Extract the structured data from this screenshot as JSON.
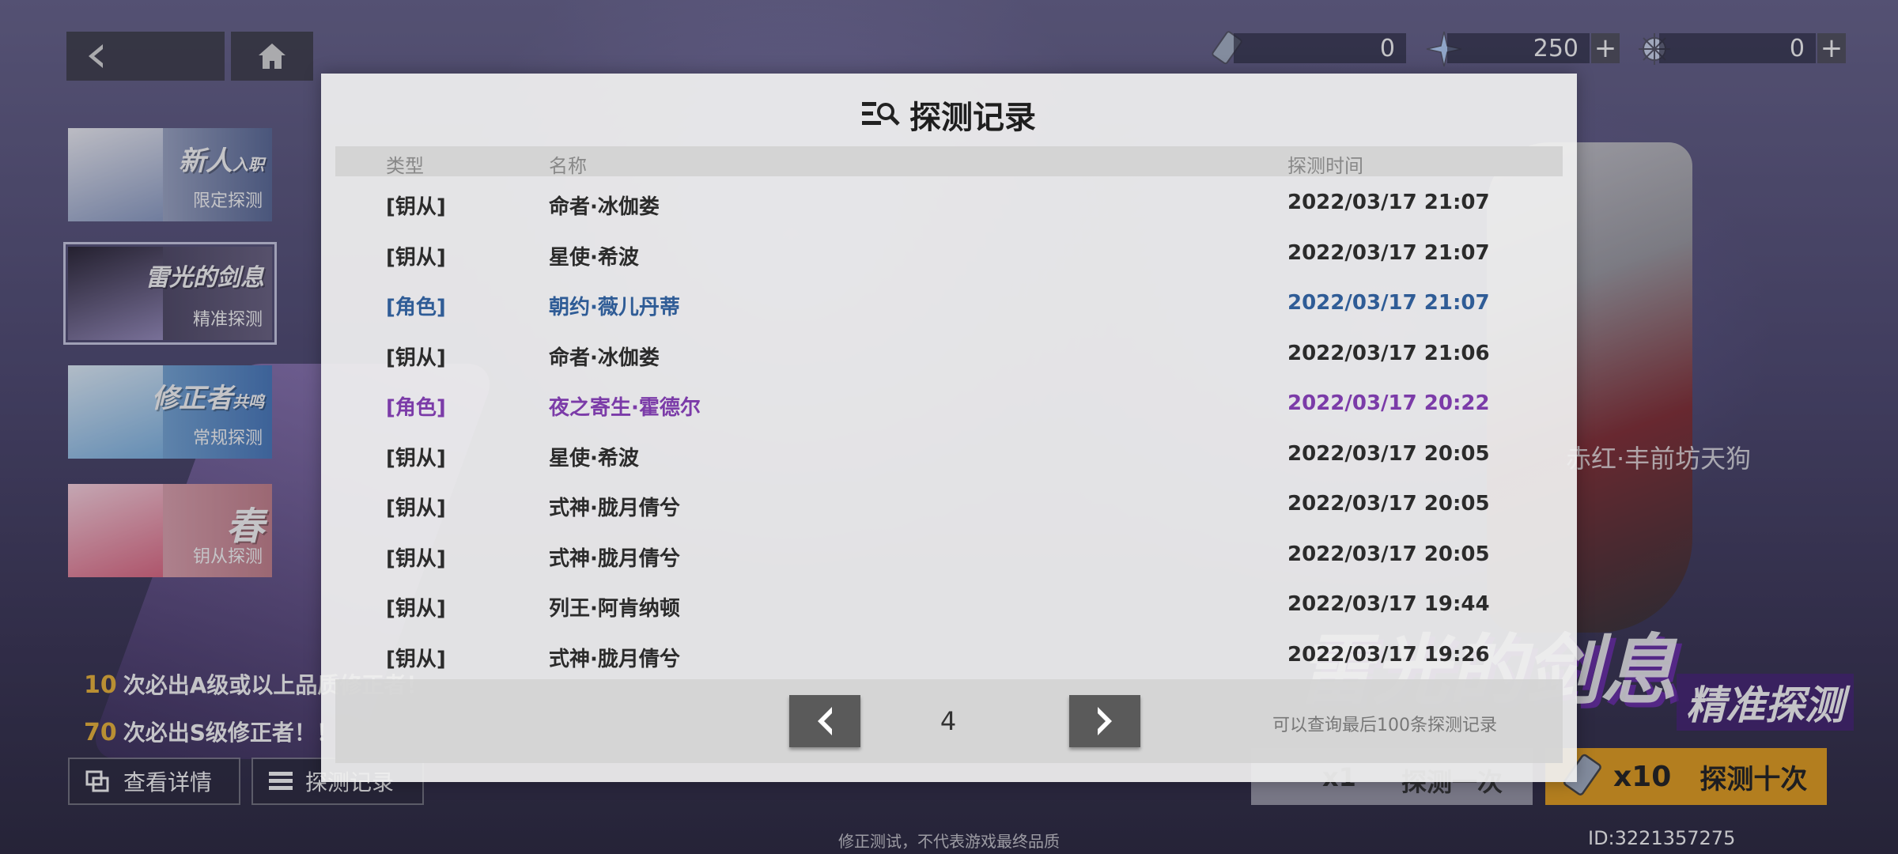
{
  "top_nav": {
    "back": "back",
    "home": "home"
  },
  "currencies": [
    {
      "icon": "card-ticket-icon",
      "value": "0"
    },
    {
      "icon": "star-crystal-icon",
      "value": "250"
    },
    {
      "icon": "snowflake-crystal-icon",
      "value": "0"
    }
  ],
  "banners": [
    {
      "title": "新人",
      "title_small": "入职",
      "sub": "限定探测"
    },
    {
      "title": "雷光的剑息",
      "sub": "精准探测"
    },
    {
      "title": "修正者",
      "title_small": "共鸣",
      "sub": "常规探测"
    },
    {
      "title": "春",
      "sub": "钥从探测"
    }
  ],
  "pity": [
    {
      "num": "10",
      "text": "次必出A级或以上品质修正者！"
    },
    {
      "num": "70",
      "text": "次必出S级修正者！！"
    }
  ],
  "bottom_buttons": {
    "details": "查看详情",
    "records": "探测记录"
  },
  "draw": {
    "one_count": "x1",
    "one_label": "探测一次",
    "ten_count": "x10",
    "ten_label": "探测十次"
  },
  "background": {
    "banner_title": "雷光的剑息",
    "banner_sub": "精准探测",
    "character_name": "赤红·丰前坊天狗"
  },
  "footer_note": "修正测试，不代表游戏最终品质",
  "uid": "ID:3221357275",
  "modal": {
    "title": "探测记录",
    "columns": {
      "type": "类型",
      "name": "名称",
      "time": "探测时间"
    },
    "rows": [
      {
        "type": "[钥从]",
        "name": "命者·冰伽娄",
        "time": "2022/03/17 21:07",
        "rarity": "normal"
      },
      {
        "type": "[钥从]",
        "name": "星使·希波",
        "time": "2022/03/17 21:07",
        "rarity": "normal"
      },
      {
        "type": "[角色]",
        "name": "朝约·薇儿丹蒂",
        "time": "2022/03/17 21:07",
        "rarity": "blue"
      },
      {
        "type": "[钥从]",
        "name": "命者·冰伽娄",
        "time": "2022/03/17 21:06",
        "rarity": "normal"
      },
      {
        "type": "[角色]",
        "name": "夜之寄生·霍德尔",
        "time": "2022/03/17 20:22",
        "rarity": "purple"
      },
      {
        "type": "[钥从]",
        "name": "星使·希波",
        "time": "2022/03/17 20:05",
        "rarity": "normal"
      },
      {
        "type": "[钥从]",
        "name": "式神·胧月倩兮",
        "time": "2022/03/17 20:05",
        "rarity": "normal"
      },
      {
        "type": "[钥从]",
        "name": "式神·胧月倩兮",
        "time": "2022/03/17 20:05",
        "rarity": "normal"
      },
      {
        "type": "[钥从]",
        "name": "列王·阿肯纳顿",
        "time": "2022/03/17 19:44",
        "rarity": "normal"
      },
      {
        "type": "[钥从]",
        "name": "式神·胧月倩兮",
        "time": "2022/03/17 19:26",
        "rarity": "normal"
      }
    ],
    "page": "4",
    "note": "可以查询最后100条探测记录"
  },
  "colors": {
    "blue_rarity": "#2f5c96",
    "purple_rarity": "#7b3ba8",
    "accent_gold": "#e8a21f"
  }
}
